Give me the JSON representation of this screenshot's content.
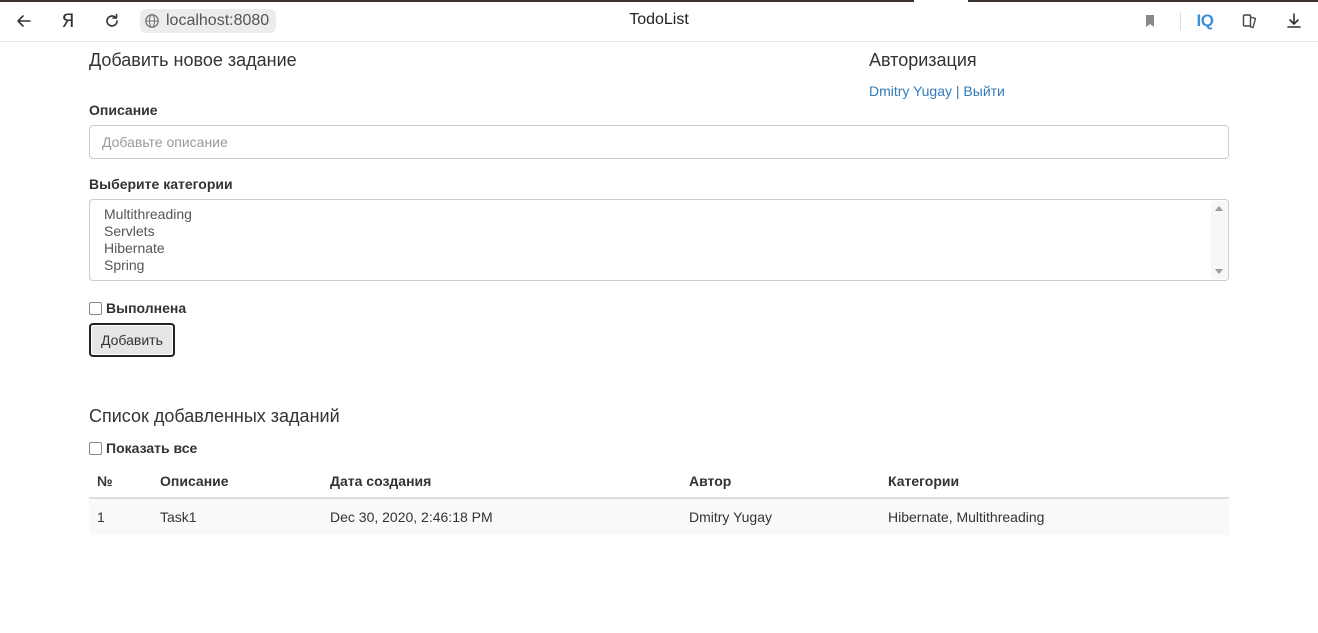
{
  "browser": {
    "url": "localhost:8080",
    "title": "TodoList",
    "yandex_glyph": "Я",
    "iq_label": "IQ",
    "icons": [
      "back-arrow-icon",
      "yandex-icon",
      "reload-icon",
      "globe-icon",
      "bookmark-icon",
      "iq-icon",
      "collections-icon",
      "download-icon"
    ]
  },
  "add_form": {
    "title": "Добавить новое задание",
    "description_label": "Описание",
    "description_placeholder": "Добавьте описание",
    "description_value": "",
    "categories_label": "Выберите категории",
    "categories": [
      "Multithreading",
      "Servlets",
      "Hibernate",
      "Spring"
    ],
    "done_label": "Выполнена",
    "submit_label": "Добавить"
  },
  "auth": {
    "title": "Авторизация",
    "user_name": "Dmitry Yugay",
    "separator": " | ",
    "logout_label": "Выйти"
  },
  "task_list": {
    "title": "Список добавленных заданий",
    "show_all_label": "Показать все",
    "columns": [
      "№",
      "Описание",
      "Дата создания",
      "Автор",
      "Категории"
    ],
    "rows": [
      [
        "1",
        "Task1",
        "Dec 30, 2020, 2:46:18 PM",
        "Dmitry Yugay",
        "Hibernate, Multithreading"
      ]
    ]
  }
}
